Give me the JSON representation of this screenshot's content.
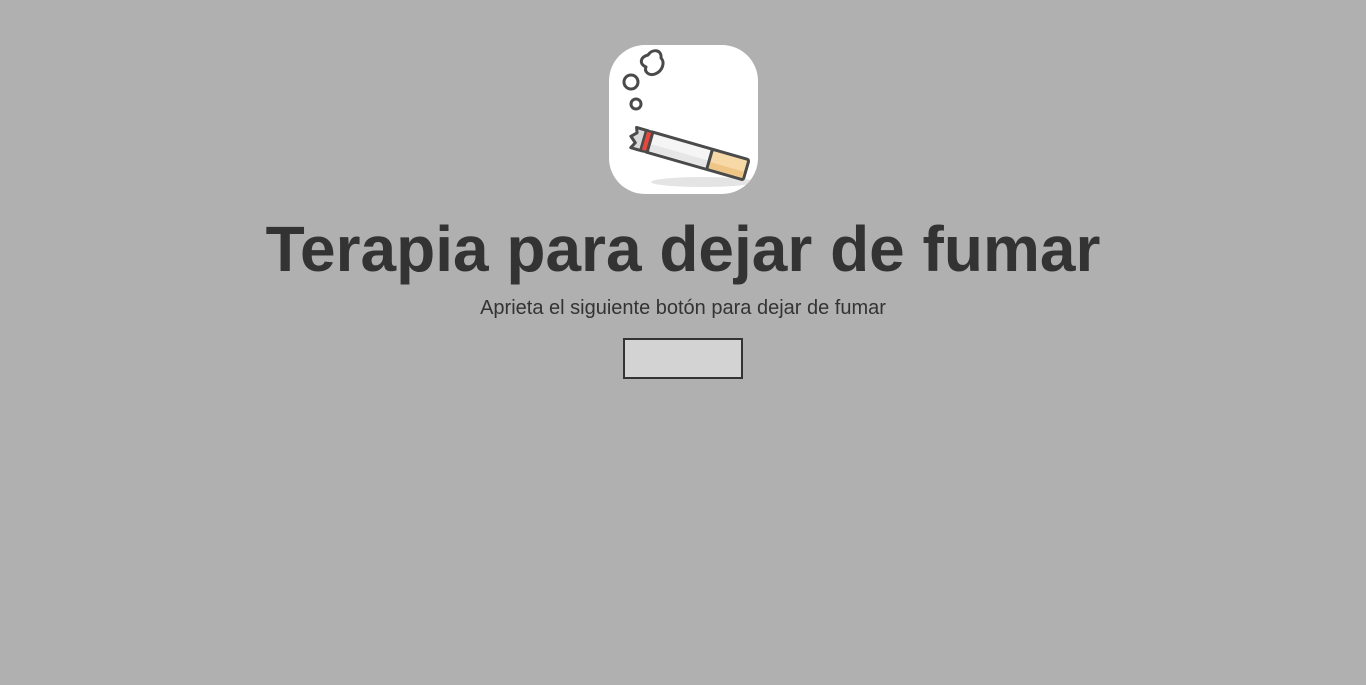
{
  "page": {
    "background_color": "#b0b0b0",
    "text_color": "#333333"
  },
  "logo": {
    "icon": "cigarette-smoke-icon",
    "background_color": "#ffffff"
  },
  "header": {
    "title": "Terapia para dejar de fumar",
    "subtitle": "Aprieta el siguiente botón para dejar de fumar"
  },
  "action": {
    "button_label": "",
    "button_color": "#d3d3d3"
  }
}
